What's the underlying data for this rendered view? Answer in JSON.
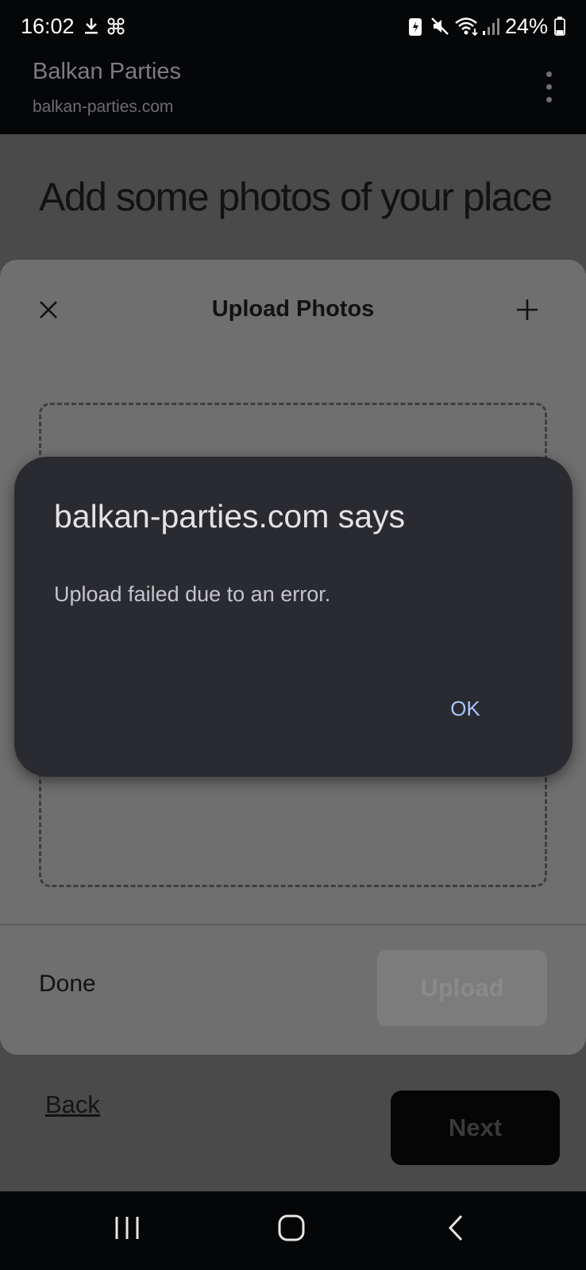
{
  "status_bar": {
    "time": "16:02",
    "battery": "24%",
    "left_icons": [
      "download-icon",
      "pinwheel-icon"
    ],
    "right_icons": [
      "battery-saver-icon",
      "mute-icon",
      "wifi-icon",
      "signal-icon",
      "battery-icon"
    ]
  },
  "browser": {
    "title": "Balkan Parties",
    "url": "balkan-parties.com",
    "menu_icon": "more-vert-icon"
  },
  "page": {
    "heading": "Add some photos of your place",
    "back_label": "Back",
    "next_label": "Next"
  },
  "sheet": {
    "title": "Upload Photos",
    "close_icon": "close-icon",
    "add_icon": "plus-icon",
    "done_label": "Done",
    "upload_label": "Upload"
  },
  "dialog": {
    "title": "balkan-parties.com says",
    "message": "Upload failed due to an error.",
    "ok_label": "OK"
  },
  "nav_bar": {
    "icons": [
      "recent-apps-icon",
      "home-icon",
      "back-icon"
    ]
  },
  "colors": {
    "dialog_bg": "#2a2b30",
    "dialog_accent": "#a9c3ff",
    "scrim": "#4a4a4a"
  }
}
